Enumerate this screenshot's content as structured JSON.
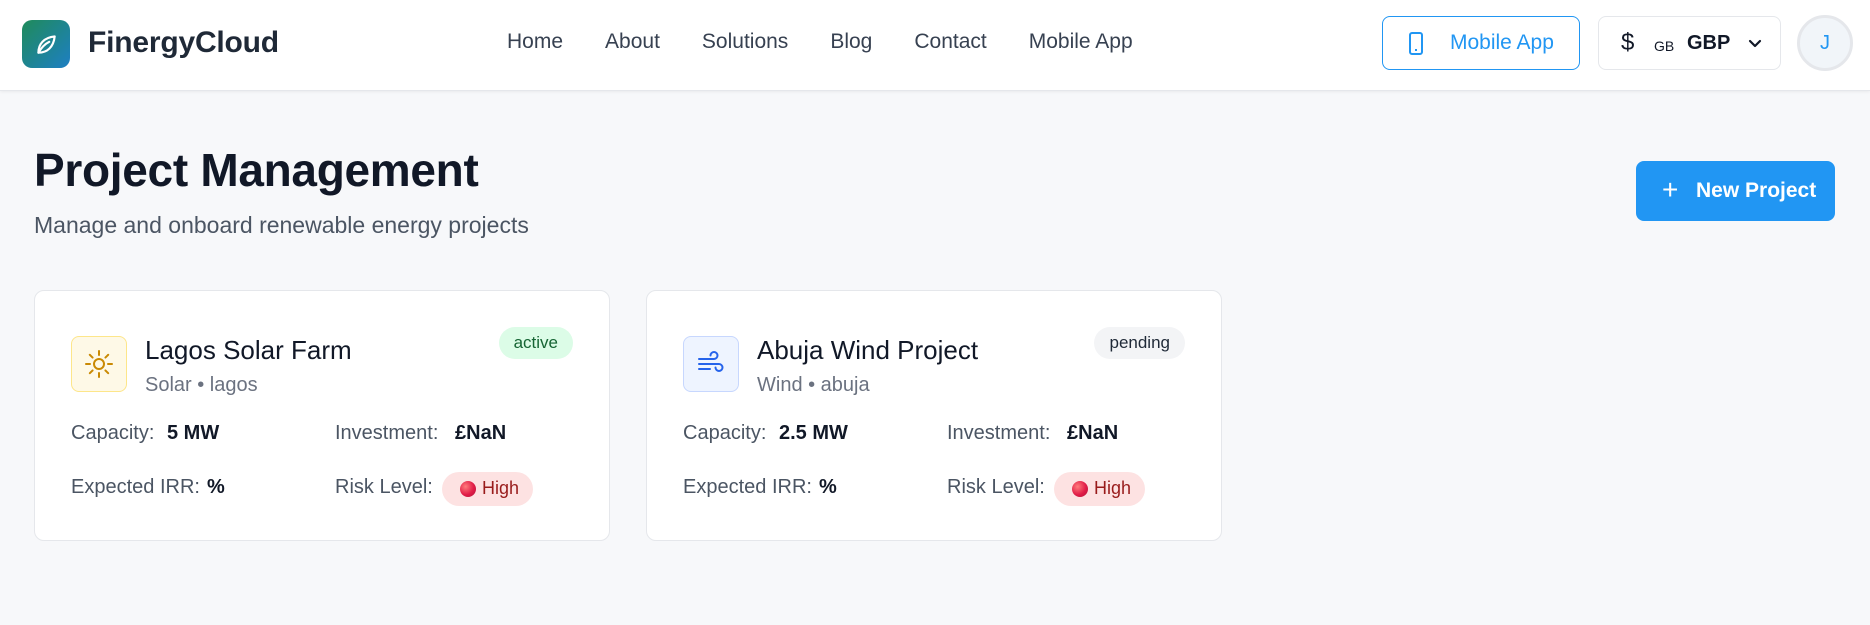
{
  "brand": {
    "name": "FinergyCloud",
    "logo_icon": "leaf-icon",
    "gradient": [
      "#1f8b5a",
      "#1e7fc4"
    ]
  },
  "nav": {
    "items": [
      "Home",
      "About",
      "Solutions",
      "Blog",
      "Contact",
      "Mobile App"
    ]
  },
  "header_actions": {
    "mobile_app_label": "Mobile App",
    "currency": {
      "symbol": "$",
      "flag": "GB",
      "code": "GBP"
    },
    "avatar_initial": "J"
  },
  "page": {
    "title": "Project Management",
    "subtitle": "Manage and onboard renewable energy projects",
    "new_project_label": "New Project"
  },
  "projects": [
    {
      "name": "Lagos Solar Farm",
      "meta": "Solar • lagos",
      "status": "active",
      "icon": "sun-icon",
      "capacity_label": "Capacity:",
      "capacity": "5 MW",
      "investment_label": "Investment:",
      "investment": "£NaN",
      "irr_label": "Expected IRR:",
      "irr": "%",
      "risk_label": "Risk Level:",
      "risk": "High"
    },
    {
      "name": "Abuja Wind Project",
      "meta": "Wind • abuja",
      "status": "pending",
      "icon": "wind-icon",
      "capacity_label": "Capacity:",
      "capacity": "2.5 MW",
      "investment_label": "Investment:",
      "investment": "£NaN",
      "irr_label": "Expected IRR:",
      "irr": "%",
      "risk_label": "Risk Level:",
      "risk": "High"
    }
  ],
  "colors": {
    "accent": "#2196f3",
    "active_badge_bg": "#dcfce7",
    "pending_badge_bg": "#f3f4f6",
    "risk_high_bg": "#fde2e2",
    "risk_high_text": "#991b1b"
  }
}
